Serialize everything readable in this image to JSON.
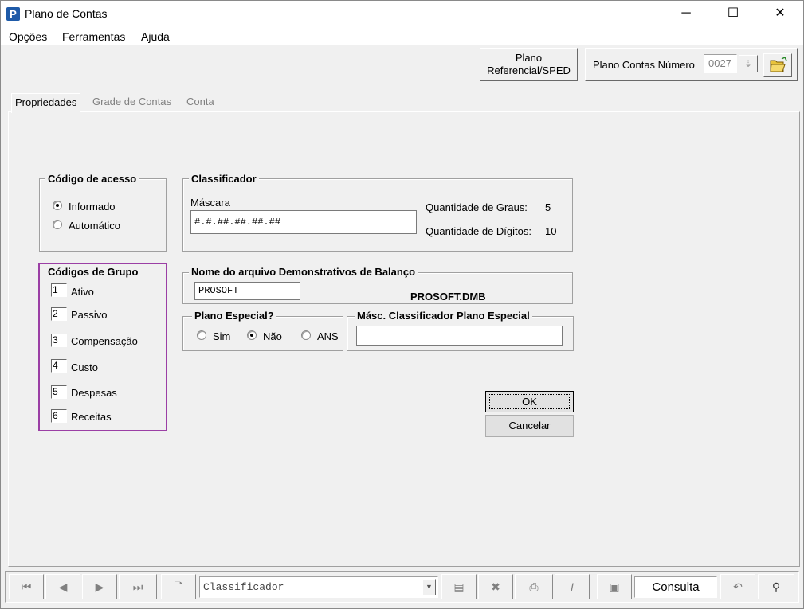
{
  "window": {
    "title": "Plano de Contas",
    "minimize_glyph": "─",
    "maximize_glyph": "☐",
    "close_glyph": "✕"
  },
  "menu": [
    "Opções",
    "Ferramentas",
    "Ajuda"
  ],
  "topbar": {
    "plano_referencial_line1": "Plano",
    "plano_referencial_line2": "Referencial/SPED",
    "plano_numero_label": "Plano Contas Número",
    "plano_numero_value": "0027"
  },
  "tabs": [
    "Propriedades",
    "Grade de Contas",
    "Conta"
  ],
  "codigo_acesso": {
    "title": "Código de acesso",
    "options": [
      "Informado",
      "Automático"
    ],
    "selected": "Informado"
  },
  "classificador": {
    "title": "Classificador",
    "mascara_label": "Máscara",
    "mascara_value": "#.#.##.##.##.##",
    "graus_label": "Quantidade de Graus:",
    "graus_value": "5",
    "digitos_label": "Quantidade de Dígitos:",
    "digitos_value": "10"
  },
  "codigos_grupo": {
    "title": "Códigos de Grupo",
    "items": [
      {
        "code": "1",
        "label": "Ativo"
      },
      {
        "code": "2",
        "label": "Passivo"
      },
      {
        "code": "3",
        "label": "Compensação"
      },
      {
        "code": "4",
        "label": "Custo"
      },
      {
        "code": "5",
        "label": "Despesas"
      },
      {
        "code": "6",
        "label": "Receitas"
      }
    ]
  },
  "demonstrativos": {
    "title": "Nome do arquivo Demonstrativos de Balanço",
    "input_value": "PROSOFT",
    "file_label": "PROSOFT.DMB"
  },
  "plano_especial": {
    "title": "Plano Especial?",
    "options": [
      "Sim",
      "Não",
      "ANS"
    ],
    "selected": "Não"
  },
  "masc_especial": {
    "title": "Másc. Classificador Plano Especial",
    "value": ""
  },
  "buttons": {
    "ok": "OK",
    "cancelar": "Cancelar"
  },
  "bottombar": {
    "search_field_value": "Classificador",
    "mode_label": "Consulta"
  },
  "colors": {
    "highlight_border": "#9b3fa5",
    "window_bg": "#f0f0f0",
    "app_icon": "#1e5aa8"
  }
}
